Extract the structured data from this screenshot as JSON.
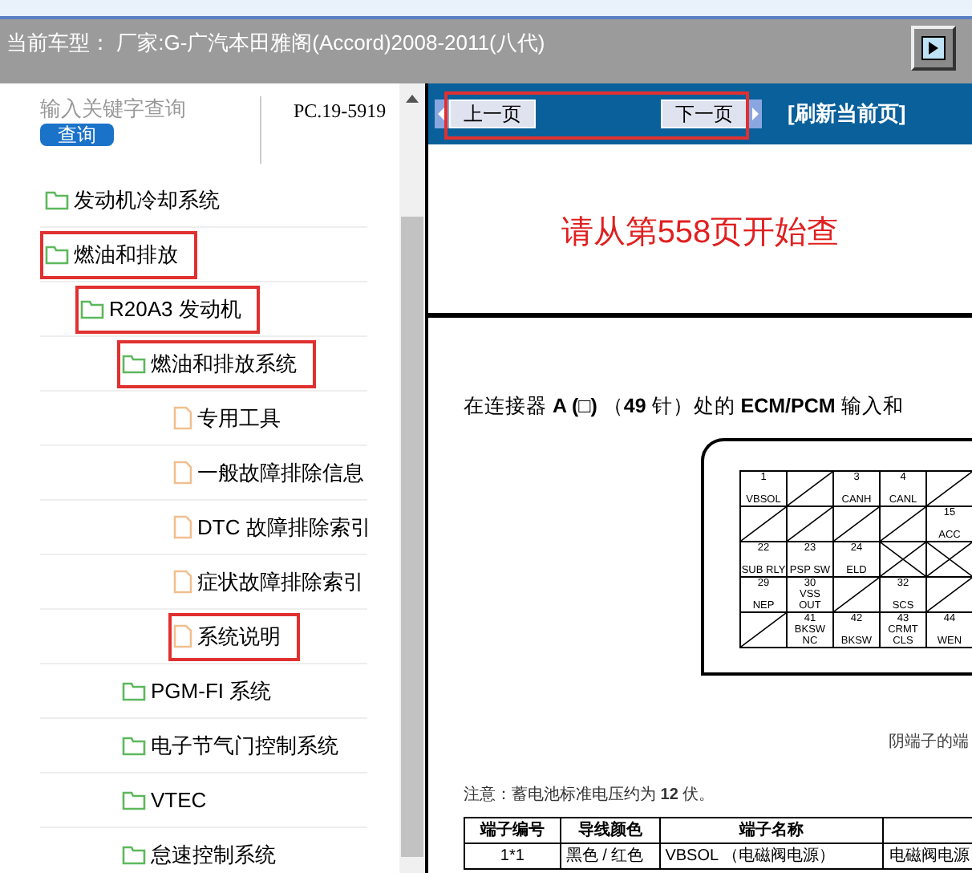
{
  "header": {
    "title": "当前车型： 厂家:G-广汽本田雅阁(Accord)2008-2011(八代)"
  },
  "search": {
    "placeholder": "输入关键字查询",
    "button": "查询",
    "page_code": "PC.19-5919"
  },
  "tree": [
    {
      "label": "发动机冷却系统",
      "kind": "folder",
      "highlighted": false
    },
    {
      "label": "燃油和排放",
      "kind": "folder",
      "highlighted": true,
      "children": [
        {
          "label": "R20A3 发动机",
          "kind": "folder",
          "highlighted": true,
          "children": [
            {
              "label": "燃油和排放系统",
              "kind": "folder",
              "highlighted": true,
              "children": [
                {
                  "label": "专用工具",
                  "kind": "file",
                  "highlighted": false
                },
                {
                  "label": "一般故障排除信息",
                  "kind": "file",
                  "highlighted": false
                },
                {
                  "label": "DTC 故障排除索引",
                  "kind": "file",
                  "highlighted": false
                },
                {
                  "label": "症状故障排除索引",
                  "kind": "file",
                  "highlighted": false
                },
                {
                  "label": "系统说明",
                  "kind": "file",
                  "highlighted": true
                }
              ]
            },
            {
              "label": "PGM-FI 系统",
              "kind": "folder",
              "highlighted": false
            },
            {
              "label": "电子节气门控制系统",
              "kind": "folder",
              "highlighted": false
            },
            {
              "label": "VTEC",
              "kind": "folder",
              "highlighted": false
            },
            {
              "label": "怠速控制系统",
              "kind": "folder",
              "highlighted": false
            }
          ]
        }
      ]
    }
  ],
  "nav": {
    "prev": "上一页",
    "next": "下一页",
    "refresh": "[刷新当前页]",
    "highlighted": true
  },
  "document": {
    "notice": "请从第558页开始查",
    "heading": "在连接器 **A (□)** （**49** 针）处的 **ECM/PCM** 输入和",
    "pins": [
      [
        {
          "kind": "pin",
          "number": "1",
          "label": "VBSOL"
        },
        {
          "kind": "blank"
        },
        {
          "kind": "pin",
          "number": "3",
          "label": "CANH"
        },
        {
          "kind": "pin",
          "number": "4",
          "label": "CANL"
        },
        {
          "kind": "blank"
        }
      ],
      [
        {
          "kind": "blank"
        },
        {
          "kind": "blank"
        },
        {
          "kind": "blank"
        },
        {
          "kind": "blank"
        },
        {
          "kind": "pin",
          "number": "15",
          "label": "ACC"
        }
      ],
      [
        {
          "kind": "pin",
          "number": "22",
          "label": "SUB RLY"
        },
        {
          "kind": "pin",
          "number": "23",
          "label": "PSP SW"
        },
        {
          "kind": "pin",
          "number": "24",
          "label": "ELD"
        },
        {
          "kind": "cross"
        },
        {
          "kind": "cross"
        }
      ],
      [
        {
          "kind": "pin",
          "number": "29",
          "label": "NEP"
        },
        {
          "kind": "pin",
          "number": "30",
          "label": "VSS OUT"
        },
        {
          "kind": "blank"
        },
        {
          "kind": "pin",
          "number": "32",
          "label": "SCS"
        },
        {
          "kind": "blank"
        }
      ],
      [
        {
          "kind": "blank"
        },
        {
          "kind": "pin",
          "number": "41",
          "label": "BKSW NC"
        },
        {
          "kind": "pin",
          "number": "42",
          "label": "BKSW"
        },
        {
          "kind": "pin",
          "number": "43",
          "label": "CRMT CLS"
        },
        {
          "kind": "pin",
          "number": "44",
          "label": "WEN"
        }
      ]
    ],
    "caption": "阴端子的端",
    "note": "注意：蓄电池标准电压约为 **12** 伏。",
    "table": {
      "columns": [
        "端子编号",
        "导线颜色",
        "端子名称"
      ],
      "rows": [
        [
          "1*1",
          "黑色 / 红色",
          "VBSOL （电磁阀电源）",
          "电磁阀电源"
        ]
      ]
    }
  }
}
